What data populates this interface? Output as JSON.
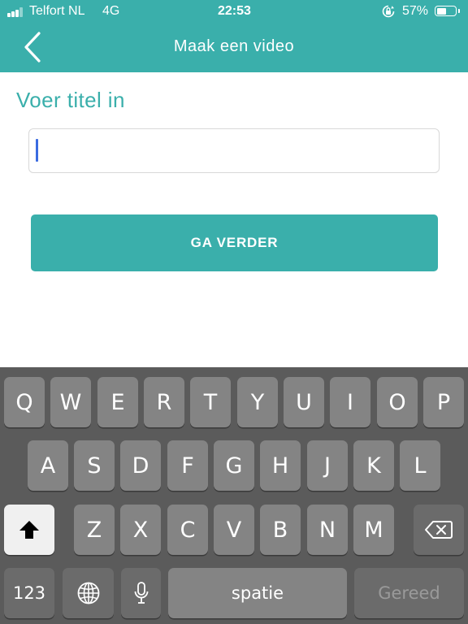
{
  "status_bar": {
    "carrier": "Telfort NL",
    "network": "4G",
    "time": "22:53",
    "battery_percent": "57%",
    "battery_level": 0.57,
    "signal_bars_filled": 3,
    "icons": [
      "signal-icon",
      "rotation-lock-icon",
      "battery-icon"
    ]
  },
  "nav": {
    "title": "Maak een video",
    "back_icon": "chevron-left-icon"
  },
  "form": {
    "label": "Voer titel in",
    "input_value": "",
    "input_placeholder": "",
    "submit_label": "GA VERDER"
  },
  "keyboard": {
    "row1": [
      "Q",
      "W",
      "E",
      "R",
      "T",
      "Y",
      "U",
      "I",
      "O",
      "P"
    ],
    "row2": [
      "A",
      "S",
      "D",
      "F",
      "G",
      "H",
      "J",
      "K",
      "L"
    ],
    "row3": [
      "Z",
      "X",
      "C",
      "V",
      "B",
      "N",
      "M"
    ],
    "numbers_label": "123",
    "space_label": "spatie",
    "done_label": "Gereed",
    "icons": [
      "shift-icon",
      "backspace-icon",
      "globe-icon",
      "microphone-icon"
    ]
  },
  "colors": {
    "accent": "#3aafab",
    "caret": "#3a6be0",
    "keyboard_bg": "#5b5b5b",
    "key_bg": "#848484"
  }
}
